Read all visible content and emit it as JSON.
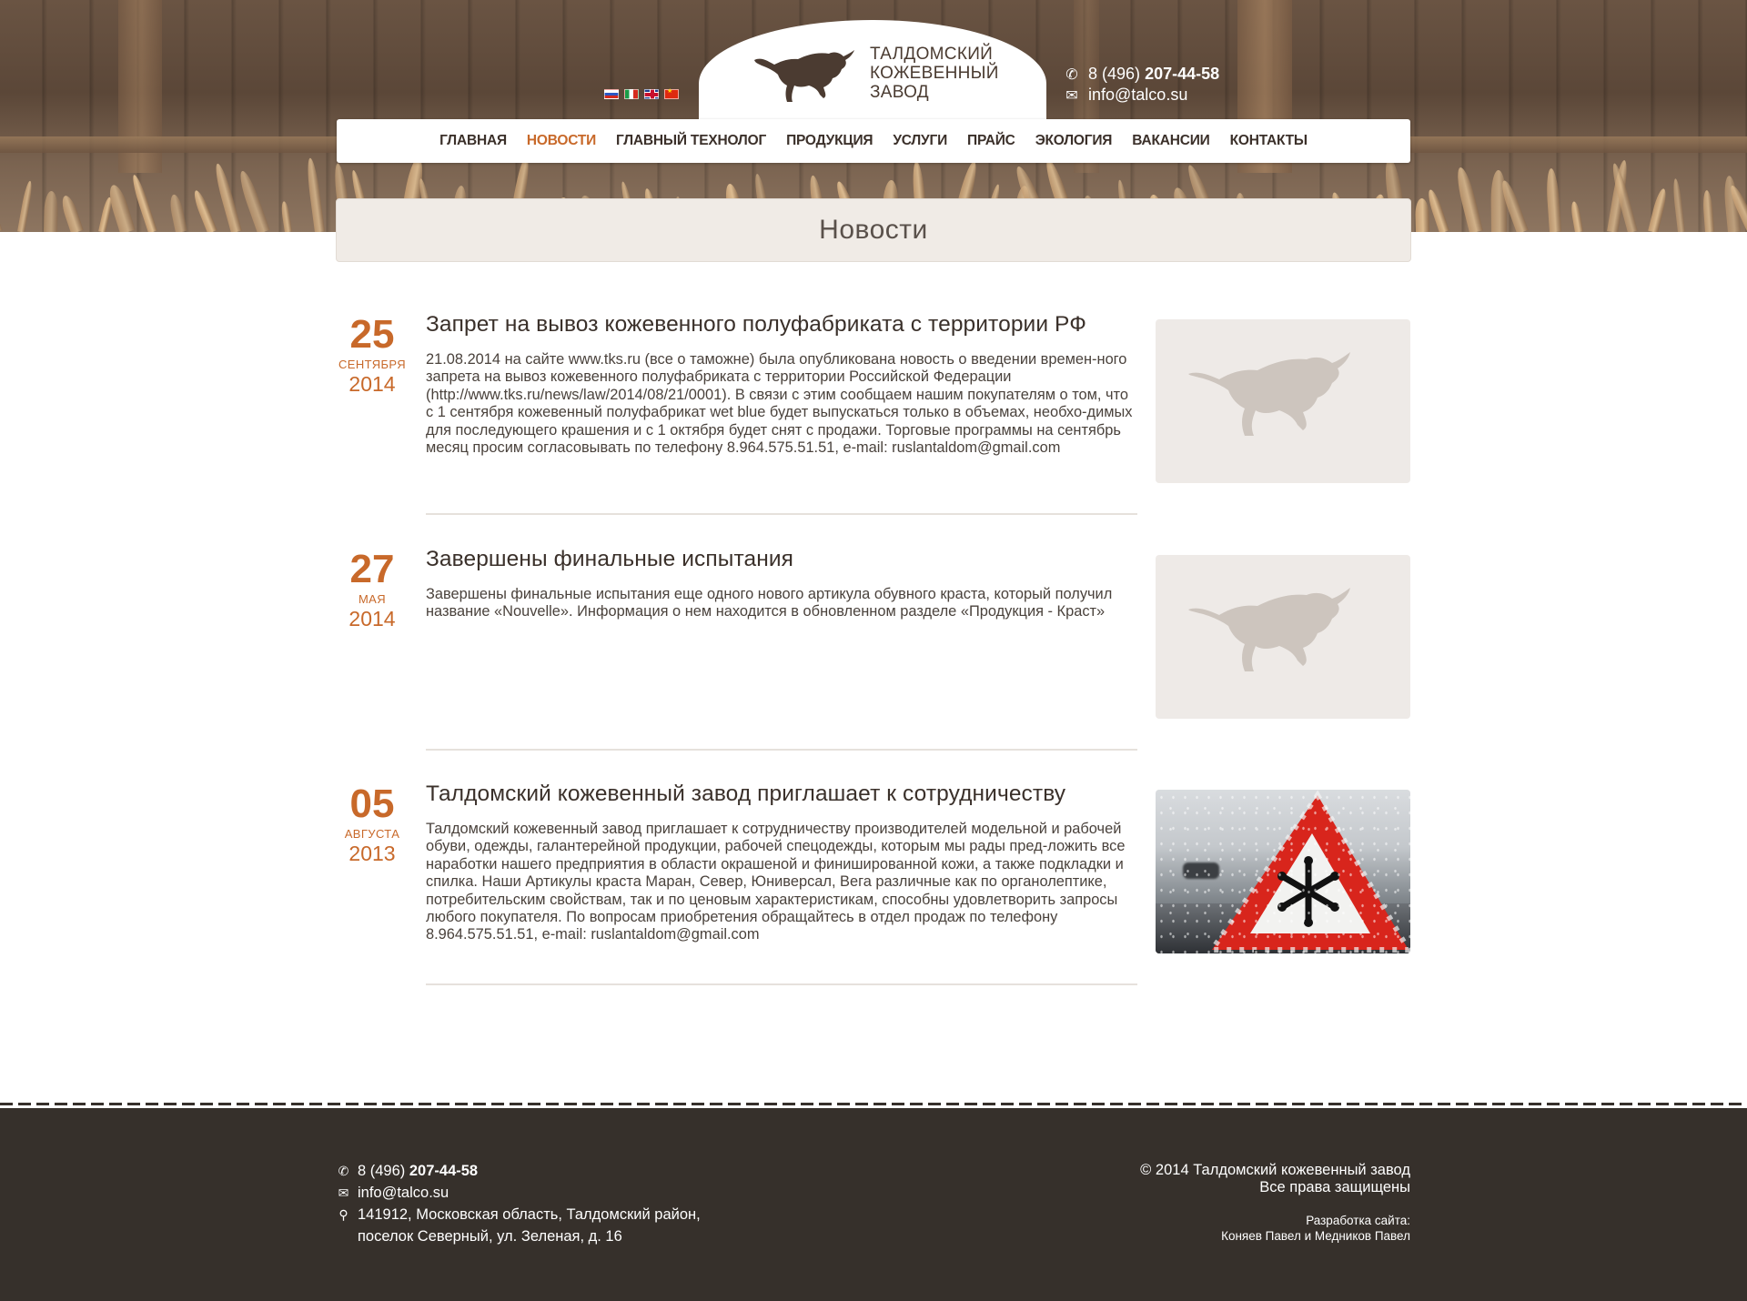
{
  "brand": {
    "name_line1": "ТАЛДОМСКИЙ",
    "name_line2": "КОЖЕВЕННЫЙ",
    "name_line3": "ЗАВОД"
  },
  "languages": [
    {
      "code": "ru",
      "icon": "flag-ru-icon"
    },
    {
      "code": "it",
      "icon": "flag-it-icon"
    },
    {
      "code": "en",
      "icon": "flag-uk-icon"
    },
    {
      "code": "cn",
      "icon": "flag-cn-icon"
    }
  ],
  "header_contacts": {
    "phone_prefix": "8 (496)",
    "phone_number": "207-44-58",
    "email": "info@talco.su"
  },
  "nav": [
    {
      "label": "ГЛАВНАЯ",
      "active": false
    },
    {
      "label": "НОВОСТИ",
      "active": true
    },
    {
      "label": "ГЛАВНЫЙ ТЕХНОЛОГ",
      "active": false
    },
    {
      "label": "ПРОДУКЦИЯ",
      "active": false
    },
    {
      "label": "УСЛУГИ",
      "active": false
    },
    {
      "label": "ПРАЙС",
      "active": false
    },
    {
      "label": "ЭКОЛОГИЯ",
      "active": false
    },
    {
      "label": "ВАКАНСИИ",
      "active": false
    },
    {
      "label": "КОНТАКТЫ",
      "active": false
    }
  ],
  "page_title": "Новости",
  "news": [
    {
      "day": "25",
      "month": "СЕНТЯБРЯ",
      "year": "2014",
      "title": "Запрет на вывоз кожевенного полуфабриката с территории РФ",
      "text": "21.08.2014 на сайте www.tks.ru (все о таможне) была опубликована новость о введении времен-ного запрета на вывоз кожевенного полуфабриката с территории Российской Федерации (http://www.tks.ru/news/law/2014/08/21/0001). В связи с этим сообщаем нашим покупателям о том, что с 1 сентября кожевенный полуфабрикат wet blue будет выпускаться только в объемах, необхо-димых для последующего крашения и с 1 октября будет снят с продажи. Торговые программы на сентябрь месяц просим согласовывать по телефону 8.964.575.51.51, e-mail: ruslantaldom@gmail.com",
      "image": "bull-placeholder-icon"
    },
    {
      "day": "27",
      "month": "МАЯ",
      "year": "2014",
      "title": "Завершены финальные испытания",
      "text": "Завершены финальные испытания еще одного нового артикула обувного краста, который получил название «Nouvelle». Информация о нем находится в обновленном разделе «Продукция - Краст»",
      "image": "bull-placeholder-icon"
    },
    {
      "day": "05",
      "month": "АВГУСТА",
      "year": "2013",
      "title": "Талдомский кожевенный завод приглашает к сотрудничеству",
      "text": "Талдомский кожевенный завод приглашает к сотрудничеству производителей модельной и рабочей обуви, одежды, галантерейной продукции, рабочей спецодежды, которым мы рады пред-ложить все наработки нашего предприятия в области окрашеной и финишированной кожи, а также подкладки и спилка. Наши Артикулы краста Маран, Север, Юниверсал, Вега различные как по органолептике, потребительским свойствам, так и по ценовым характеристикам, способны удовлетворить запросы любого покупателя. По вопросам приобретения обращайтесь в отдел продаж по телефону 8.964.575.51.51, e-mail: ruslantaldom@gmail.com",
      "image": "snow-warning-sign-photo"
    }
  ],
  "footer": {
    "phone_prefix": "8 (496)",
    "phone_number": "207-44-58",
    "email": "info@talco.su",
    "address_line1": "141912, Московская область, Талдомский район,",
    "address_line2": "поселок Северный, ул. Зеленая, д. 16",
    "copyright": "© 2014 Талдомский кожевенный завод",
    "rights": "Все права защищены",
    "dev_label": "Разработка сайта:",
    "dev_names": "Коняев Павел и Медников Павел"
  },
  "colors": {
    "accent": "#c8692a",
    "footer_bg": "#36302b",
    "title_bar_bg": "#f0ebe6",
    "placeholder_bg": "#eeeae7"
  }
}
